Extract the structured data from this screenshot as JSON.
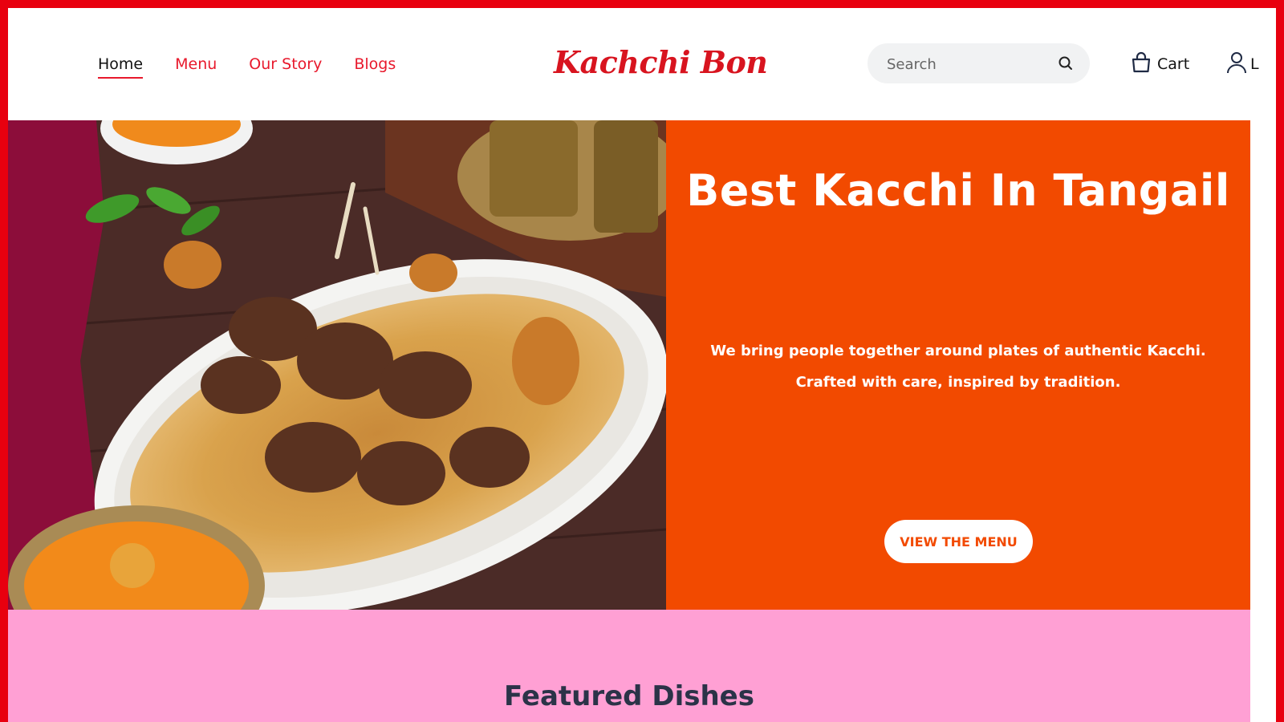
{
  "nav": {
    "items": [
      {
        "label": "Home",
        "active": true
      },
      {
        "label": "Menu",
        "active": false
      },
      {
        "label": "Our Story",
        "active": false
      },
      {
        "label": "Blogs",
        "active": false
      }
    ]
  },
  "brand": {
    "name": "Kachchi Bon"
  },
  "search": {
    "placeholder": "Search",
    "icon": "search-icon"
  },
  "cart": {
    "label": "Cart",
    "icon": "shopping-bag-icon"
  },
  "account": {
    "label": "L",
    "icon": "user-icon"
  },
  "hero": {
    "title": "Best Kacchi In Tangail",
    "text_line1": "We bring people together around plates of authentic Kacchi.",
    "text_line2": "Crafted with care, inspired by tradition.",
    "cta_label": "VIEW THE MENU"
  },
  "featured": {
    "heading": "Featured Dishes"
  },
  "colors": {
    "frame": "#e8000f",
    "accent": "#e8192c",
    "hero_panel": "#f24a00",
    "featured_bg": "#ffa0d4"
  }
}
